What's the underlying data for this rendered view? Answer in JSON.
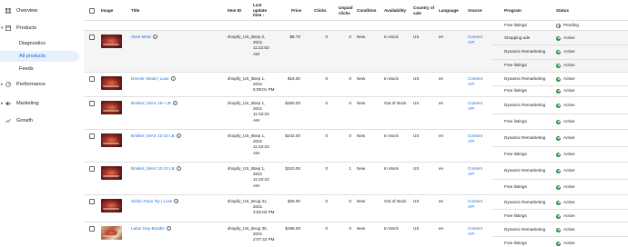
{
  "sidebar": {
    "items": [
      {
        "label": "Overview",
        "icon": "grid-icon"
      },
      {
        "label": "Products",
        "icon": "box-icon"
      },
      {
        "label": "Diagnostics"
      },
      {
        "label": "All products"
      },
      {
        "label": "Feeds"
      },
      {
        "label": "Performance",
        "icon": "performance-icon"
      },
      {
        "label": "Marketing",
        "icon": "marketing-icon"
      },
      {
        "label": "Growth",
        "icon": "trending-up-icon"
      }
    ]
  },
  "table": {
    "headers": {
      "image": "Image",
      "title": "Title",
      "item_id": "Item ID",
      "last_update": "Last update time",
      "price": "Price",
      "clicks": "Clicks",
      "unpaid_clicks": "Unpaid clicks",
      "condition": "Condition",
      "availability": "Availability",
      "country": "Country of sale",
      "language": "Language",
      "source": "Source",
      "program": "Program",
      "status": "Status"
    },
    "top_partial": {
      "program": "Free listings",
      "status": "Pending"
    },
    "rows": [
      {
        "title": "Stew Meat",
        "item_id": "shopify_US_6",
        "time": [
          "Sep 2,",
          "2021",
          "11:22:53",
          "AM"
        ],
        "price": "$8.70",
        "clicks": "0",
        "unpaid": "0",
        "condition": "New",
        "availability": "In stock",
        "country": "US",
        "language": "en",
        "source": [
          "Content",
          "API"
        ],
        "programs": [
          {
            "name": "Shopping ads",
            "status": "Active"
          },
          {
            "name": "Dynamic Remarketing",
            "status": "Active"
          },
          {
            "name": "Free listings",
            "status": "Active"
          }
        ]
      },
      {
        "title": "Denver Steak | Luxe",
        "item_id": "shopify_US_6",
        "time": [
          "Sep 1,",
          "2021",
          "5:08:01 PM"
        ],
        "price": "$16.00",
        "clicks": "0",
        "unpaid": "0",
        "condition": "New",
        "availability": "In stock",
        "country": "US",
        "language": "en",
        "source": [
          "Content",
          "API"
        ],
        "programs": [
          {
            "name": "Dynamic Remarketing",
            "status": "Active"
          },
          {
            "name": "Free listings",
            "status": "Active"
          }
        ]
      },
      {
        "title": "Brisket | MAX 15+ LB",
        "item_id": "shopify_US_6",
        "time": [
          "Sep 1,",
          "2021",
          "11:32:23",
          "AM"
        ],
        "price": "$260.00",
        "clicks": "0",
        "unpaid": "0",
        "condition": "New",
        "availability": "Out of stock",
        "country": "US",
        "language": "en",
        "source": [
          "Content",
          "API"
        ],
        "programs": [
          {
            "name": "Dynamic Remarketing",
            "status": "Active"
          },
          {
            "name": "Free listings",
            "status": "Active"
          }
        ]
      },
      {
        "title": "Brisket | MAX 13-15 LB",
        "item_id": "shopify_US_6",
        "time": [
          "Sep 1,",
          "2021",
          "11:32:23",
          "AM"
        ],
        "price": "$242.00",
        "clicks": "0",
        "unpaid": "0",
        "condition": "New",
        "availability": "In stock",
        "country": "US",
        "language": "en",
        "source": [
          "Content",
          "API"
        ],
        "programs": [
          {
            "name": "Dynamic Remarketing",
            "status": "Active"
          },
          {
            "name": "Free listings",
            "status": "Active"
          }
        ]
      },
      {
        "title": "Brisket | MAX 10-13 LB",
        "item_id": "shopify_US_6",
        "time": [
          "Sep 1,",
          "2021",
          "11:32:23",
          "AM"
        ],
        "price": "$210.00",
        "clicks": "0",
        "unpaid": "1",
        "condition": "New",
        "availability": "In stock",
        "country": "US",
        "language": "en",
        "source": [
          "Content",
          "API"
        ],
        "programs": [
          {
            "name": "Dynamic Remarketing",
            "status": "Active"
          },
          {
            "name": "Free listings",
            "status": "Active"
          }
        ]
      },
      {
        "title": "Sirloin Faux Tip | Luxe",
        "item_id": "shopify_US_6",
        "time": [
          "Aug 31,",
          "2021",
          "3:52:03 PM"
        ],
        "price": "$26.00",
        "clicks": "0",
        "unpaid": "0",
        "condition": "New",
        "availability": "Out of stock",
        "country": "US",
        "language": "en",
        "source": [
          "Content",
          "API"
        ],
        "programs": [
          {
            "name": "Dynamic Remarketing",
            "status": "Active"
          },
          {
            "name": "Free listings",
            "status": "Active"
          }
        ]
      },
      {
        "title": "Labor Day Bundle",
        "item_id": "shopify_US_6",
        "time": [
          "Aug 30,",
          "2021",
          "2:07:42 PM"
        ],
        "price": "$196.00",
        "clicks": "0",
        "unpaid": "0",
        "condition": "New",
        "availability": "In stock",
        "country": "US",
        "language": "en",
        "source": [
          "Content",
          "API"
        ],
        "programs": [
          {
            "name": "Dynamic Remarketing",
            "status": "Active"
          },
          {
            "name": "Free listings",
            "status": "Active"
          }
        ]
      }
    ]
  },
  "colors": {
    "accent": "#1a73e8",
    "active": "#1e8e3e",
    "nav_active_bg": "#e8f0fe"
  }
}
